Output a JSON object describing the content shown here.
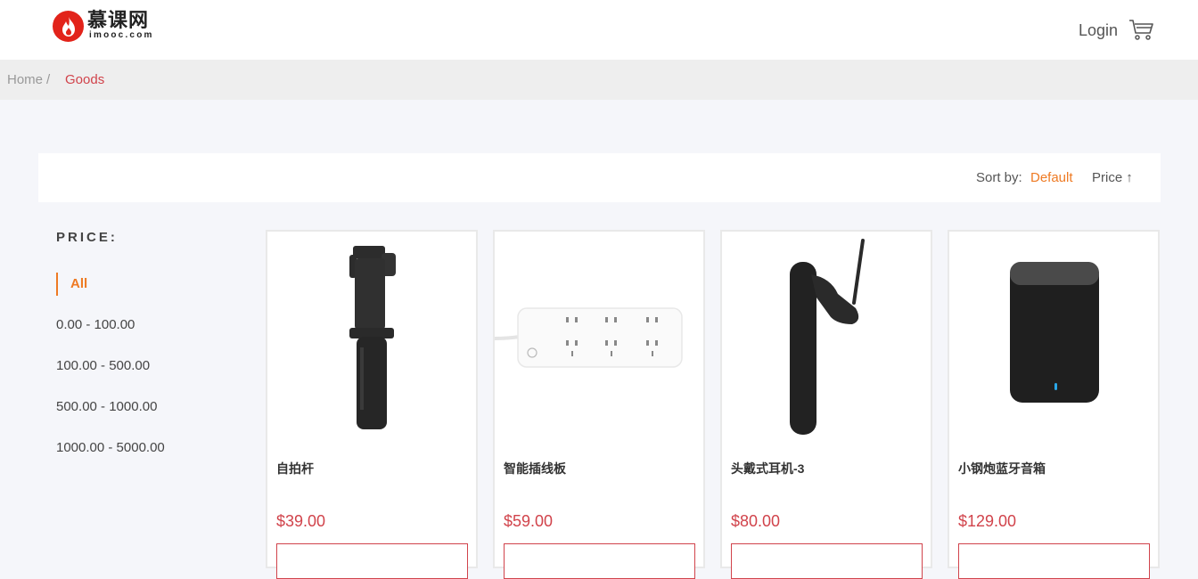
{
  "header": {
    "logo_cn": "慕课网",
    "logo_en": "imooc.com",
    "login_label": "Login",
    "cart_icon": "shopping-cart-icon"
  },
  "breadcrumb": {
    "home": "Home",
    "separator": "/",
    "current": "Goods"
  },
  "sort": {
    "label": "Sort by:",
    "default_label": "Default",
    "price_label": "Price",
    "price_arrow": "↑"
  },
  "filter": {
    "title": "PRICE:",
    "items": [
      "All",
      "0.00 - 100.00",
      "100.00 - 500.00",
      "500.00 - 1000.00",
      "1000.00 - 5000.00"
    ]
  },
  "goods": [
    {
      "name": "自拍杆",
      "price": "$39.00",
      "image": "selfie-stick"
    },
    {
      "name": "智能插线板",
      "price": "$59.00",
      "image": "power-strip"
    },
    {
      "name": "头戴式耳机-3",
      "price": "$80.00",
      "image": "bluetooth-earpiece"
    },
    {
      "name": "小钢炮蓝牙音箱",
      "price": "$129.00",
      "image": "bluetooth-speaker"
    }
  ],
  "colors": {
    "accent_orange": "#ee7a23",
    "accent_red": "#d1434b",
    "brand_red": "#e2231a"
  }
}
